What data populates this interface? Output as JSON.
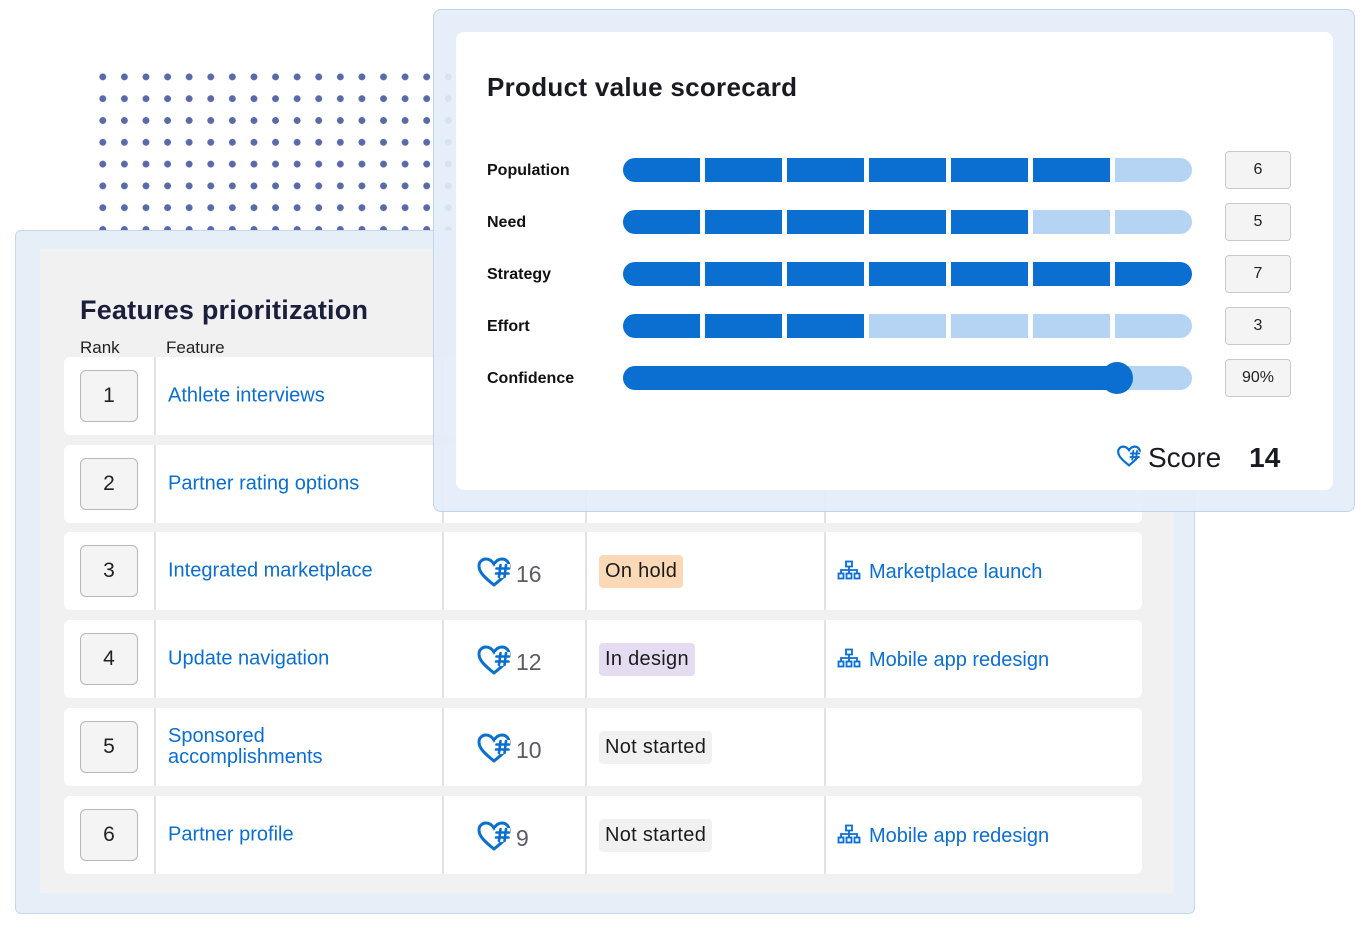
{
  "features": {
    "title": "Features prioritization",
    "columns": {
      "rank": "Rank",
      "feature": "Feature"
    },
    "rows": [
      {
        "rank": "1",
        "feature": "Athlete interviews",
        "score": "",
        "status": "",
        "status_color": "",
        "initiative": ""
      },
      {
        "rank": "2",
        "feature": "Partner rating options",
        "score": "",
        "status": "",
        "status_color": "",
        "initiative": ""
      },
      {
        "rank": "3",
        "feature": "Integrated marketplace",
        "score": "16",
        "status": "On hold",
        "status_color": "#fcd9b6",
        "initiative": "Marketplace launch"
      },
      {
        "rank": "4",
        "feature": "Update navigation",
        "score": "12",
        "status": "In design",
        "status_color": "#e6dcf2",
        "initiative": "Mobile app redesign"
      },
      {
        "rank": "5",
        "feature": "Sponsored accomplishments",
        "score": "10",
        "status": "Not started",
        "status_color": "#f1f1f2",
        "initiative": ""
      },
      {
        "rank": "6",
        "feature": "Partner profile",
        "score": "9",
        "status": "Not started",
        "status_color": "#f1f1f2",
        "initiative": "Mobile app redesign"
      }
    ]
  },
  "scorecard": {
    "title": "Product value scorecard",
    "segments_total": 7,
    "metrics": [
      {
        "label": "Population",
        "value": "6",
        "filled": 6
      },
      {
        "label": "Need",
        "value": "5",
        "filled": 5
      },
      {
        "label": "Strategy",
        "value": "7",
        "filled": 7
      },
      {
        "label": "Effort",
        "value": "3",
        "filled": 3
      }
    ],
    "confidence": {
      "label": "Confidence",
      "value": "90%",
      "fraction": 0.9
    },
    "score_label": "Score",
    "score_value": "14"
  },
  "colors": {
    "accent": "#0a6fd1",
    "accent_light": "#b5d4f3",
    "title_dark": "#1b1f3b"
  },
  "icons": {
    "score": "heart-hash-icon",
    "initiative": "org-chart-icon"
  }
}
